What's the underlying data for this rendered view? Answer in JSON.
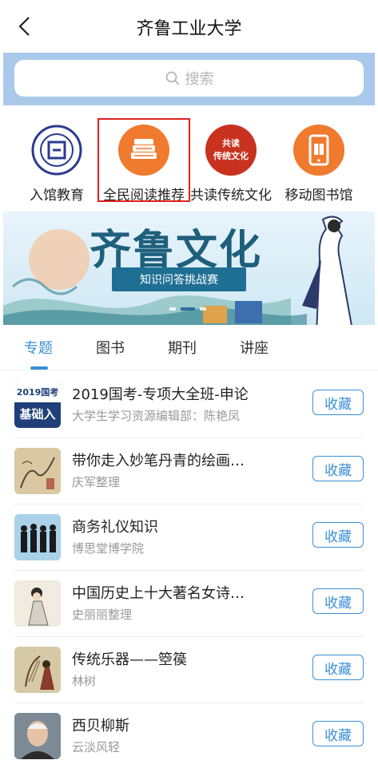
{
  "header": {
    "title": "齐鲁工业大学"
  },
  "search": {
    "placeholder": "搜索"
  },
  "quick_icons": [
    {
      "label": "入馆教育",
      "icon": "university-seal-icon"
    },
    {
      "label": "全民阅读推荐",
      "icon": "books-stack-icon"
    },
    {
      "label": "共读传统文化",
      "icon": "traditional-culture-badge-icon",
      "badge_text": "共读\n传统文化"
    },
    {
      "label": "移动图书馆",
      "icon": "mobile-library-icon"
    }
  ],
  "banner": {
    "title": "齐鲁文化",
    "subtitle": "知识问答挑战赛"
  },
  "tabs": [
    "专题",
    "图书",
    "期刊",
    "讲座"
  ],
  "list": [
    {
      "title": "2019国考-专项大全班-申论",
      "subtitle": "大学生学习资源编辑部：陈艳凤",
      "button": "收藏",
      "thumb_top": "2019国考",
      "thumb_bottom": "基础入"
    },
    {
      "title": "带你走入妙笔丹青的绘画…",
      "subtitle": "庆军整理",
      "button": "收藏"
    },
    {
      "title": "商务礼仪知识",
      "subtitle": "博思堂博学院",
      "button": "收藏"
    },
    {
      "title": "中国历史上十大著名女诗…",
      "subtitle": "史丽丽整理",
      "button": "收藏"
    },
    {
      "title": "传统乐器——箜篌",
      "subtitle": "林树",
      "button": "收藏"
    },
    {
      "title": "西贝柳斯",
      "subtitle": "云淡风轻",
      "button": "收藏"
    }
  ],
  "colors": {
    "accent": "#3b8fd8",
    "search_band": "#a9c9ea",
    "highlight": "#e02020",
    "orange": "#f07a2e"
  }
}
